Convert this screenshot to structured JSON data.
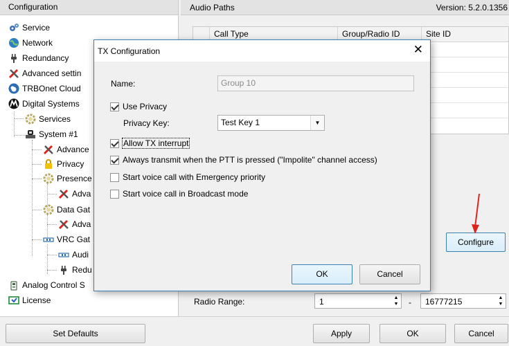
{
  "left_panel": {
    "header": "Configuration",
    "tree": {
      "service": "Service",
      "network": "Network",
      "redundancy": "Redundancy",
      "advanced": "Advanced settin",
      "cloud": "TRBOnet Cloud",
      "digital": "Digital Systems",
      "services": "Services",
      "system1": "System #1",
      "adv1": "Advance",
      "privacy": "Privacy",
      "presence": "Presence",
      "adv2": "Adva",
      "datagate": "Data Gat",
      "adv3": "Adva",
      "vrc": "VRC Gat",
      "audio": "Audi",
      "red": "Redu",
      "analog": "Analog Control S",
      "license": "License"
    },
    "set_defaults": "Set Defaults"
  },
  "right_panel": {
    "header": "Audio Paths",
    "version": "Version: 5.2.0.1356",
    "columns": [
      "",
      "Call Type",
      "Group/Radio ID",
      "Site ID"
    ],
    "configure": "Configure",
    "radio_range_label": "Radio Range:",
    "range_from": "1",
    "range_sep": "-",
    "range_to": "16777215"
  },
  "bottom": {
    "apply": "Apply",
    "ok": "OK",
    "cancel": "Cancel"
  },
  "dialog": {
    "title": "TX Configuration",
    "close": "✕",
    "name_label": "Name:",
    "name_value": "Group 10",
    "use_privacy": "Use Privacy",
    "privacy_key_label": "Privacy Key:",
    "privacy_key_value": "Test Key 1",
    "allow_tx": "Allow TX interrupt",
    "always_transmit": "Always transmit when the PTT is pressed (\"Impolite\" channel access)",
    "emergency": "Start voice call with Emergency priority",
    "broadcast": "Start voice call in Broadcast mode",
    "ok": "OK",
    "cancel": "Cancel",
    "checks": {
      "use_privacy": true,
      "allow_tx": true,
      "always_transmit": true,
      "emergency": false,
      "broadcast": false
    }
  },
  "colors": {
    "accent": "#3c7fb1",
    "arrow": "#d9251c"
  }
}
